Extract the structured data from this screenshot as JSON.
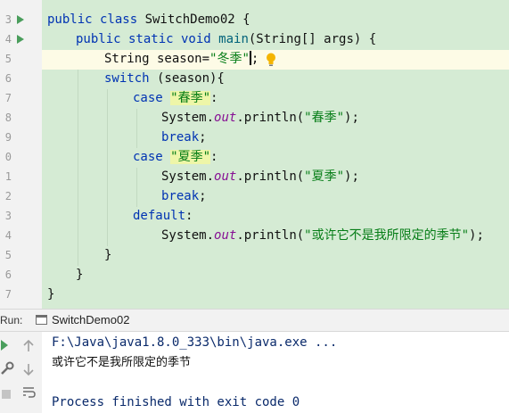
{
  "editor": {
    "line_numbers": [
      "3",
      "4",
      "5",
      "6",
      "7",
      "8",
      "9",
      "0",
      "1",
      "2",
      "3",
      "4",
      "5",
      "6",
      "7"
    ],
    "lines": {
      "l1": {
        "kw": "public class ",
        "rest": "SwitchDemo02 {"
      },
      "l2": {
        "kw1": "public static void ",
        "name": "main",
        "rest": "(String[] args) {"
      },
      "l3": {
        "pre": "String season=",
        "str": "\"冬季\"",
        "post": ";"
      },
      "l4": {
        "kw": "switch",
        "rest": " (season){"
      },
      "l5": {
        "kw": "case ",
        "str": "\"春季\"",
        "rest": ":"
      },
      "l6": {
        "pre": "System.",
        "fld": "out",
        "mid": ".println(",
        "str": "\"春季\"",
        "post": ");"
      },
      "l7": {
        "kw": "break",
        "rest": ";"
      },
      "l8": {
        "kw": "case ",
        "str": "\"夏季\"",
        "rest": ":"
      },
      "l9": {
        "pre": "System.",
        "fld": "out",
        "mid": ".println(",
        "str": "\"夏季\"",
        "post": ");"
      },
      "l10": {
        "kw": "break",
        "rest": ";"
      },
      "l11": {
        "kw": "default",
        "rest": ":"
      },
      "l12": {
        "pre": "System.",
        "fld": "out",
        "mid": ".println(",
        "str": "\"或许它不是我所限定的季节\"",
        "post": ");"
      },
      "l13": {
        "text": "}"
      },
      "l14": {
        "text": "}"
      },
      "l15": {
        "text": "}"
      }
    }
  },
  "run_panel": {
    "label": "Run:",
    "tab": "SwitchDemo02",
    "console": {
      "command": "F:\\Java\\java1.8.0_333\\bin\\java.exe ...",
      "output": "或许它不是我所限定的季节",
      "exit": "Process finished with exit code 0"
    }
  },
  "colors": {
    "code_bg": "#d5ebd4",
    "keyword": "#0033b3",
    "string": "#067d17",
    "field": "#871094",
    "run_arrow": "#4a9e5c"
  },
  "icons": {
    "run_gutter": "run-arrow-icon",
    "intention": "lightbulb-icon",
    "tab": "console-tab-icon",
    "rerun": "rerun-icon",
    "up": "arrow-up-icon",
    "settings": "wrench-icon",
    "down": "arrow-down-icon",
    "stop": "stop-icon",
    "wrap": "soft-wrap-icon"
  }
}
